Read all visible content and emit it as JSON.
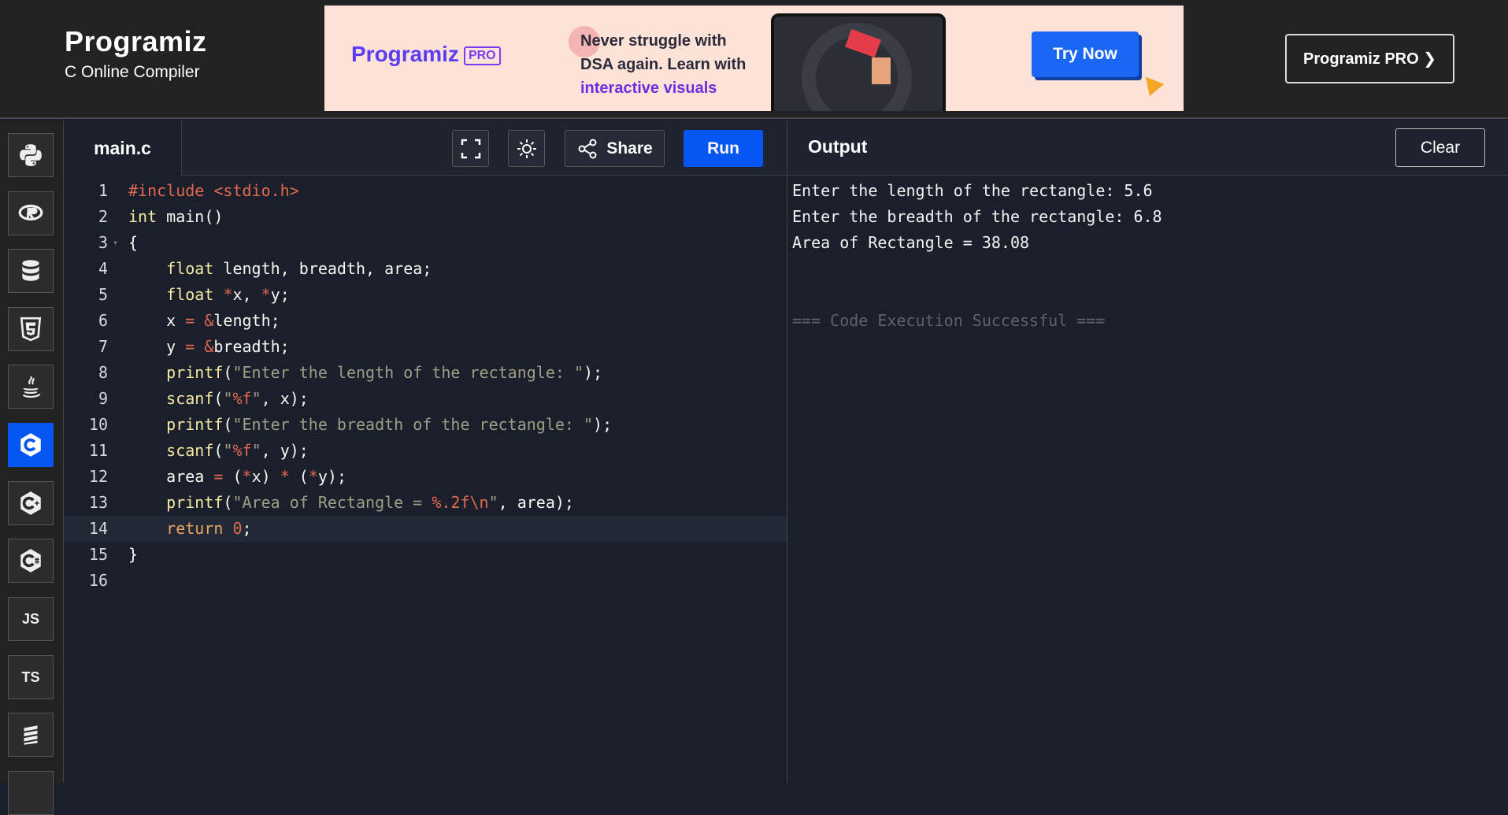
{
  "header": {
    "logo_text": "Programiz",
    "subtitle": "C Online Compiler",
    "pro_button": "Programiz PRO ❯"
  },
  "ad": {
    "logo_text": "Programiz",
    "pro_badge": "PRO",
    "headline_1": "Never struggle with",
    "headline_2": "DSA again. Learn with",
    "headline_3": "interactive visuals",
    "cta": "Try Now"
  },
  "sidebar": {
    "languages": [
      {
        "name": "python-icon",
        "label": ""
      },
      {
        "name": "r-icon",
        "label": ""
      },
      {
        "name": "sql-icon",
        "label": ""
      },
      {
        "name": "html-icon",
        "label": ""
      },
      {
        "name": "java-icon",
        "label": ""
      },
      {
        "name": "c-icon",
        "label": "",
        "active": true
      },
      {
        "name": "cpp-icon",
        "label": ""
      },
      {
        "name": "csharp-icon",
        "label": ""
      },
      {
        "name": "js-icon",
        "label": "JS"
      },
      {
        "name": "ts-icon",
        "label": "TS"
      },
      {
        "name": "swift-icon",
        "label": ""
      }
    ]
  },
  "editor": {
    "file_name": "main.c",
    "share_label": "Share",
    "run_label": "Run",
    "current_line": 14,
    "line_numbers": [
      "1",
      "2",
      "3",
      "4",
      "5",
      "6",
      "7",
      "8",
      "9",
      "10",
      "11",
      "12",
      "13",
      "14",
      "15",
      "16"
    ]
  },
  "output": {
    "title": "Output",
    "clear_label": "Clear",
    "lines": [
      "Enter the length of the rectangle: 5.6",
      "Enter the breadth of the rectangle: 6.8",
      "Area of Rectangle = 38.08",
      "=== Code Execution Successful ==="
    ]
  },
  "colors": {
    "accent": "#0556f3",
    "editor_bg": "#1b1f2b",
    "header_bg": "#222222"
  }
}
